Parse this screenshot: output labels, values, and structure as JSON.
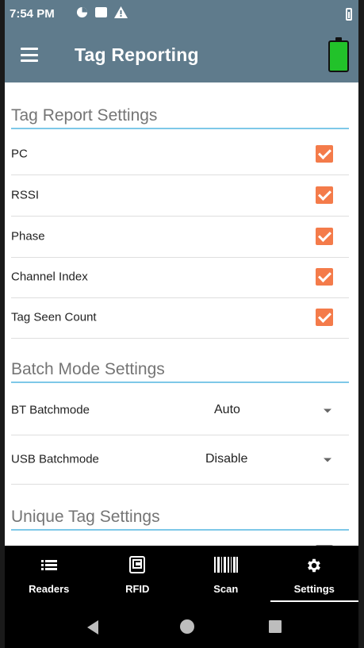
{
  "status_bar": {
    "time": "7:54 PM",
    "icons": [
      "data-saver-icon",
      "message-icon",
      "warning-icon",
      "battery-icon"
    ]
  },
  "app_bar": {
    "title": "Tag Reporting",
    "menu_icon": "hamburger-menu-icon",
    "battery_icon": "device-battery-icon",
    "battery_color": "#22c22a"
  },
  "sections": {
    "tag_report": {
      "header": "Tag Report Settings",
      "items": [
        {
          "label": "PC",
          "checked": true
        },
        {
          "label": "RSSI",
          "checked": true
        },
        {
          "label": "Phase",
          "checked": true
        },
        {
          "label": "Channel Index",
          "checked": true
        },
        {
          "label": "Tag Seen Count",
          "checked": true
        }
      ]
    },
    "batch_mode": {
      "header": "Batch Mode Settings",
      "items": [
        {
          "label": "BT Batchmode",
          "value": "Auto"
        },
        {
          "label": "USB Batchmode",
          "value": "Disable"
        }
      ]
    },
    "unique_tag": {
      "header": "Unique Tag Settings"
    }
  },
  "bottom_nav": [
    {
      "label": "Readers",
      "icon": "list-icon",
      "active": false
    },
    {
      "label": "RFID",
      "icon": "rfid-icon",
      "active": false
    },
    {
      "label": "Scan",
      "icon": "barcode-icon",
      "active": false
    },
    {
      "label": "Settings",
      "icon": "gear-icon",
      "active": true
    }
  ],
  "colors": {
    "app_bar": "#5f7b8c",
    "checkbox": "#f47b4a",
    "section_underline": "#7ec8e8"
  }
}
